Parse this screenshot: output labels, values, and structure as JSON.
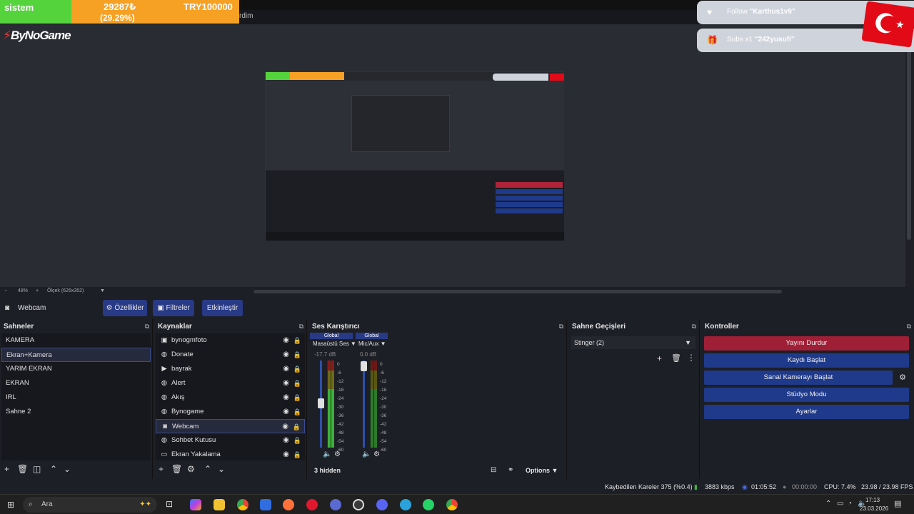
{
  "window": {
    "title": "rdim"
  },
  "overlay": {
    "label": "sistem",
    "amount": "29287₺",
    "percent": "(29.29%)",
    "goal": "TRY100000",
    "logo_prefix": "By",
    "logo_suffix": "NoGame"
  },
  "notifications": [
    {
      "prefix": "Follow",
      "name": "\"Karthus1v9\""
    },
    {
      "prefix": "Subs x1",
      "name": "\"242yusufi\""
    }
  ],
  "preview_bar": {
    "zoom": "48%",
    "scale": "Ölçek (626x352)"
  },
  "source_toolbar": {
    "selected": "Webcam",
    "properties": "Özellikler",
    "filters": "Filtreler",
    "activate": "Etkinleştir"
  },
  "scenes": {
    "title": "Sahneler",
    "items": [
      "KAMERA",
      "Ekran+Kamera",
      "YARIM EKRAN",
      "EKRAN",
      "IRL",
      "Sahne 2"
    ],
    "selected_index": 1
  },
  "sources": {
    "title": "Kaynaklar",
    "items": [
      {
        "name": "bynogmfoto",
        "icon": "image-icon"
      },
      {
        "name": "Donate",
        "icon": "globe-icon"
      },
      {
        "name": "bayrak",
        "icon": "play-icon"
      },
      {
        "name": "Alert",
        "icon": "globe-icon"
      },
      {
        "name": "Akış",
        "icon": "globe-icon"
      },
      {
        "name": "Bynogame",
        "icon": "globe-icon"
      },
      {
        "name": "Webcam",
        "icon": "camera-icon"
      },
      {
        "name": "Sohbet Kutusu",
        "icon": "globe-icon"
      },
      {
        "name": "Ekran Yakalama",
        "icon": "monitor-icon"
      }
    ],
    "selected_index": 6
  },
  "mixer": {
    "title": "Ses Karıştırıcı",
    "channels": [
      {
        "badge": "Global",
        "name": "Masaüstü Ses",
        "db": "-17.7 dB",
        "level": 0.62
      },
      {
        "badge": "Global",
        "name": "Mic/Aux",
        "db": "0.0 dB",
        "level": 0.97
      }
    ],
    "scale": [
      "0",
      "-6",
      "-12",
      "-18",
      "-24",
      "-30",
      "-36",
      "-42",
      "-48",
      "-54",
      "-60"
    ],
    "hidden": "3 hidden",
    "options": "Options"
  },
  "transitions": {
    "title": "Sahne Geçişleri",
    "selected": "Stinger (2)"
  },
  "controls": {
    "title": "Kontroller",
    "buttons": [
      "Yayını Durdur",
      "Kaydı Başlat",
      "Sanal Kamerayı Başlat",
      "Stüdyo Modu",
      "Ayarlar"
    ]
  },
  "status": {
    "dropped": "Kaybedilen Kareler 375 (%0.4)",
    "bitrate": "3883 kbps",
    "stream_time": "01:05:52",
    "rec_time": "00:00:00",
    "cpu": "CPU: 7.4%",
    "fps": "23.98 / 23.98 FPS"
  },
  "taskbar": {
    "search": "Ara",
    "time": "17:13",
    "date": "23.03.2026"
  },
  "colors": {
    "accent": "#283a86",
    "stop": "#9e1f36",
    "green": "#55d33c",
    "orange": "#f6a024"
  }
}
